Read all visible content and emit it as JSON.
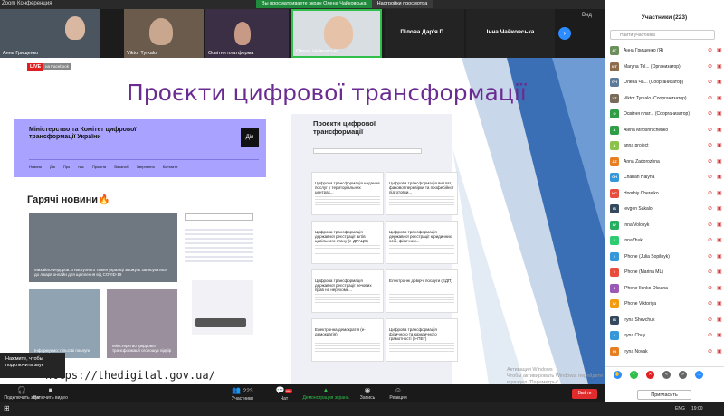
{
  "app": {
    "title": "Zoom Конференция"
  },
  "share": {
    "status": "Вы просматриваете экран Олена Чайковська",
    "view_options": "Настройки просмотра"
  },
  "video_strip": {
    "tiles": [
      {
        "name": "Анна Грищенко"
      },
      {
        "name": "Viktor Tyrkalo"
      },
      {
        "name": "Освітня платформа"
      },
      {
        "name": "Олена Чайковська"
      }
    ],
    "name_tiles": [
      {
        "name": "Пілова Дар'я П..."
      },
      {
        "name": "Інна Чайковська"
      }
    ],
    "view_label": "Вид"
  },
  "slide": {
    "live_badge": "LIVE",
    "facebook_badge": "на Facebook",
    "title": "Проєкти цифрової трансформації",
    "left_site": {
      "header": "Міністерство та Комітет цифрової трансформації України",
      "logo": "Дія",
      "nav": "Новини Дія Про нас Проекти Вакансії Звернення Контакти",
      "hot_news": "Гарячі новини🔥",
      "news": [
        {
          "caption": "Михайло Федоров: з наступного тижня українці зможуть записуватися до лікаря онлайн для щеплення від COVID-19"
        },
        {
          "caption": "Інформуємо: пільгові послуги"
        },
        {
          "caption": "Міністерство цифрової трансформації оголошує відбір"
        }
      ],
      "url": "https://thedigital.gov.ua/"
    },
    "right_site": {
      "title": "Проєкти цифрової трансформації",
      "cards": [
        {
          "title": "Цифрова трансформація надання послуг у територіальних центрах..."
        },
        {
          "title": "Цифрова трансформація виплат, фахової перевірки та професійної підготовки..."
        },
        {
          "title": "Цифрова трансформація державної реєстрації актів цивільного стану (e-ДРАЦС)"
        },
        {
          "title": "Цифрова трансформація державної реєстрації юридичних осіб, фізичних..."
        },
        {
          "title": "Цифрова трансформація державної реєстрації речових прав на нерухоме..."
        },
        {
          "title": "Електронні довірчі послуги (ЕДП)"
        },
        {
          "title": "Електронна демократія (e-демократія)"
        },
        {
          "title": "Цифрова трансформація фізичного та юридичного грамотності (e-ПЕГ)"
        }
      ]
    },
    "activation": {
      "line1": "Активация Windows",
      "line2": "Чтобы активировать Windows, перейдите в раздел \"Параметры\"."
    }
  },
  "notice": {
    "text": "Нажмите, чтобы подключить звук"
  },
  "toolbar": {
    "sound": "Подключить звук",
    "video": "Включить видео",
    "participants": "Участники",
    "participants_count": "223",
    "chat": "Чат",
    "chat_badge": "99+",
    "share": "Демонстрация экрана",
    "record": "Запись",
    "reactions": "Реакции",
    "end": "Выйти"
  },
  "panel": {
    "title": "Участники (223)",
    "search_placeholder": "Найти участника",
    "invite": "Пригласить",
    "participants": [
      {
        "name": "Анна Грищенко (Я)",
        "initials": "АГ",
        "color": "#6a8f5a"
      },
      {
        "name": "Maryna Tol... (Организатор)",
        "initials": "MT",
        "color": "#8e6b4a"
      },
      {
        "name": "Олена Ча... (Соорганизатор)",
        "initials": "ОЧ",
        "color": "#5c7a9a"
      },
      {
        "name": "Viktor Tyrkalo (Соорганизатор)",
        "initials": "VT",
        "color": "#7a6a5a"
      },
      {
        "name": "Освітня плат... (Соорганизатор)",
        "initials": "О",
        "color": "#2f9e44"
      },
      {
        "name": "Alena Miroshnichenko",
        "initials": "A",
        "color": "#2f9e44"
      },
      {
        "name": "anna project",
        "initials": "A",
        "color": "#8bc34a"
      },
      {
        "name": "Anna Zadorozhna",
        "initials": "AZ",
        "color": "#e67e22"
      },
      {
        "name": "Chaban Halyna",
        "initials": "CH",
        "color": "#3498db"
      },
      {
        "name": "Hoorhiy Chereiko",
        "initials": "HC",
        "color": "#e74c3c"
      },
      {
        "name": "Ievgen Sakalo",
        "initials": "IS",
        "color": "#34495e"
      },
      {
        "name": "Inna Voloxyk",
        "initials": "IV",
        "color": "#27ae60"
      },
      {
        "name": "InnaZhuk",
        "initials": "I",
        "color": "#2ecc71"
      },
      {
        "name": "iPhone (Julia Sopilnyk)",
        "initials": "I",
        "color": "#3498db"
      },
      {
        "name": "iPhone (Marina ML)",
        "initials": "I",
        "color": "#e74c3c"
      },
      {
        "name": "iPhone Ilenko Oksana",
        "initials": "II",
        "color": "#9b59b6"
      },
      {
        "name": "iPhone Viktoriya",
        "initials": "IV",
        "color": "#f39c12"
      },
      {
        "name": "Iryna Shevchuk",
        "initials": "IS",
        "color": "#34495e"
      },
      {
        "name": "Iryna Chuy",
        "initials": "I",
        "color": "#3498db"
      },
      {
        "name": "Iryna Novak",
        "initials": "IN",
        "color": "#e67e22"
      }
    ]
  },
  "taskbar": {
    "lang": "ENG",
    "time": "19:00"
  }
}
